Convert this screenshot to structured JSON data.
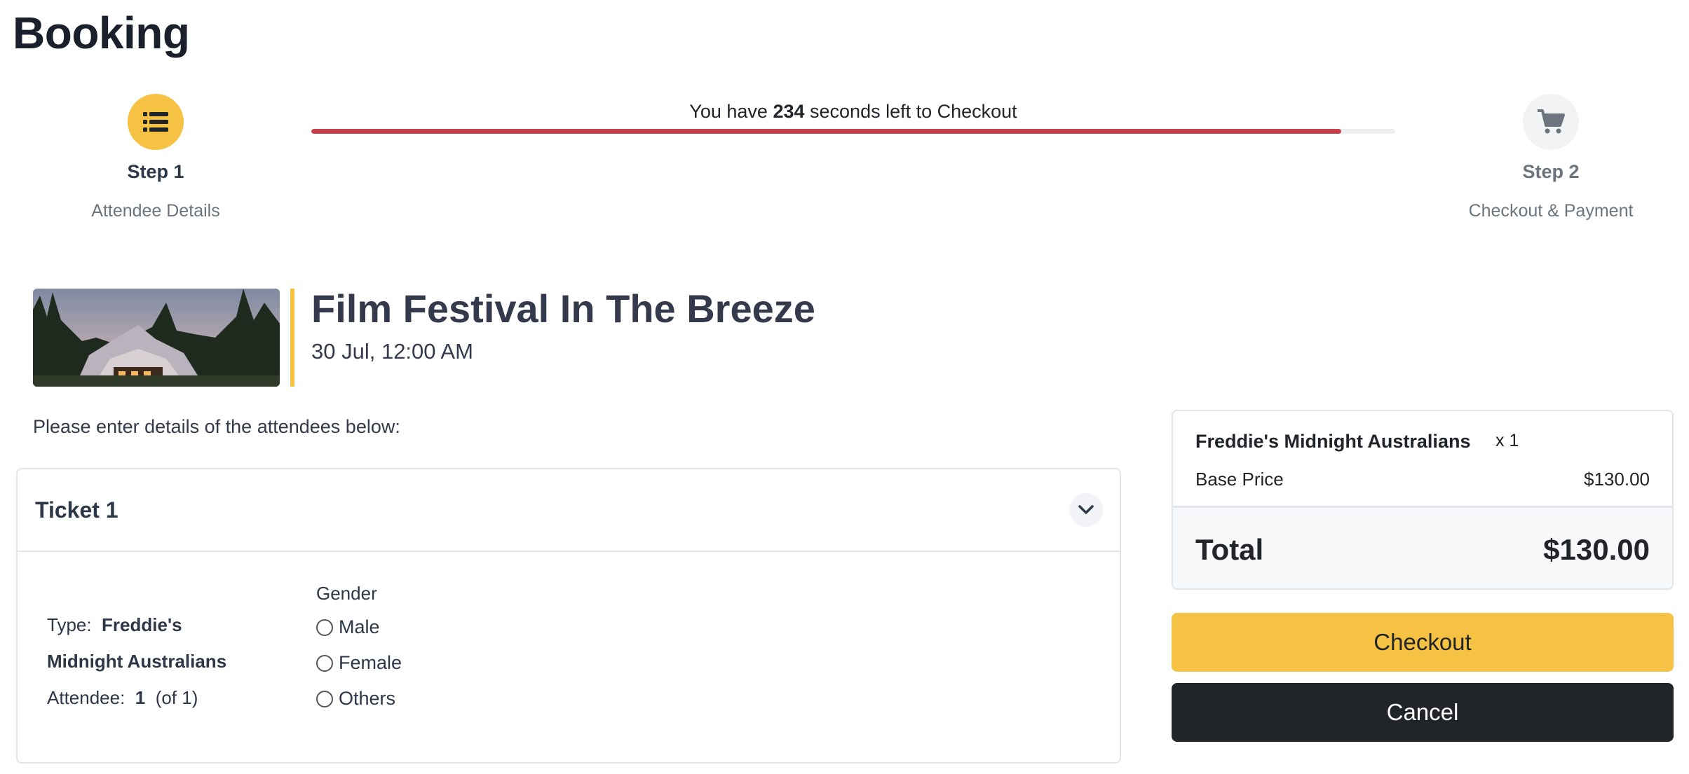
{
  "page": {
    "title": "Booking"
  },
  "stepper": {
    "steps": [
      {
        "label": "Step 1",
        "description": "Attendee Details",
        "icon": "list-icon",
        "active": true
      },
      {
        "label": "Step 2",
        "description": "Checkout & Payment",
        "icon": "cart-icon",
        "active": false
      }
    ],
    "timer": {
      "prefix": "You have",
      "seconds": "234",
      "suffix": "seconds left to Checkout",
      "remaining_fraction": 0.95
    }
  },
  "event": {
    "title": "Film Festival In The Breeze",
    "date": "30 Jul, 12:00 AM",
    "image": "event-tent-photo"
  },
  "instructions": "Please enter details of the attendees below:",
  "ticket": {
    "title": "Ticket 1",
    "type_label": "Type:",
    "type_value": "Freddie's Midnight Australians",
    "attendee_label": "Attendee:",
    "attendee_number": "1",
    "attendee_total": "(of 1)",
    "gender": {
      "label": "Gender",
      "options": [
        "Male",
        "Female",
        "Others"
      ],
      "selected": null
    }
  },
  "summary": {
    "item_name": "Freddie's Midnight Australians",
    "item_qty": "x 1",
    "base_price_label": "Base Price",
    "base_price_value": "$130.00",
    "total_label": "Total",
    "total_value": "$130.00"
  },
  "actions": {
    "checkout": "Checkout",
    "cancel": "Cancel"
  },
  "colors": {
    "accent": "#f6c244",
    "timer_bar": "#c9404b",
    "dark": "#212529"
  }
}
